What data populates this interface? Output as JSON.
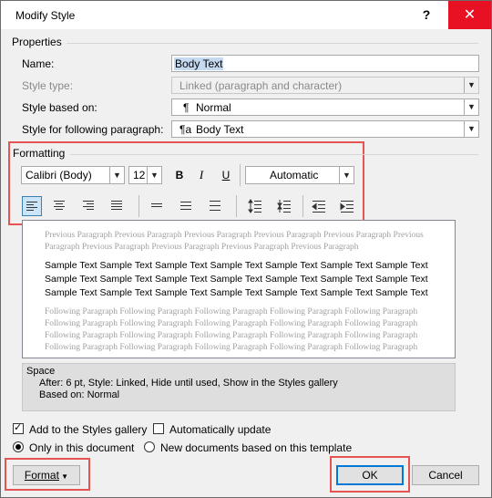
{
  "window": {
    "title": "Modify Style",
    "help_label": "?",
    "close_label": "✕"
  },
  "properties": {
    "heading": "Properties",
    "name_label": "Name:",
    "name_value": "Body Text",
    "style_type_label": "Style type:",
    "style_type_value": "Linked (paragraph and character)",
    "based_on_label": "Style based on:",
    "based_on_value": "Normal",
    "based_on_icon": "¶",
    "following_label": "Style for following paragraph:",
    "following_value": "Body Text",
    "following_icon": "¶a"
  },
  "formatting": {
    "heading": "Formatting",
    "font": "Calibri (Body)",
    "size": "12",
    "bold": "B",
    "italic": "I",
    "underline": "U",
    "color": "Automatic"
  },
  "preview": {
    "previous": "Previous Paragraph Previous Paragraph Previous Paragraph Previous Paragraph Previous Paragraph Previous Paragraph Previous Paragraph Previous Paragraph Previous Paragraph Previous Paragraph",
    "sample": "Sample Text Sample Text Sample Text Sample Text Sample Text Sample Text Sample Text Sample Text Sample Text Sample Text Sample Text Sample Text Sample Text Sample Text Sample Text Sample Text Sample Text Sample Text Sample Text Sample Text Sample Text",
    "following": "Following Paragraph Following Paragraph Following Paragraph Following Paragraph Following Paragraph Following Paragraph Following Paragraph Following Paragraph Following Paragraph Following Paragraph Following Paragraph Following Paragraph Following Paragraph Following Paragraph Following Paragraph Following Paragraph Following Paragraph Following Paragraph Following Paragraph Following Paragraph"
  },
  "description": {
    "line1": "Space",
    "line2": "After:  6 pt, Style: Linked, Hide until used, Show in the Styles gallery",
    "line3": "Based on: Normal"
  },
  "options": {
    "add_gallery": "Add to the Styles gallery",
    "auto_update": "Automatically update",
    "only_doc": "Only in this document",
    "new_docs": "New documents based on this template"
  },
  "buttons": {
    "format": "Format",
    "ok": "OK",
    "cancel": "Cancel"
  },
  "colors": {
    "highlight_red": "#e55353",
    "close_red": "#e81123",
    "selected_blue": "#cce4f7"
  }
}
